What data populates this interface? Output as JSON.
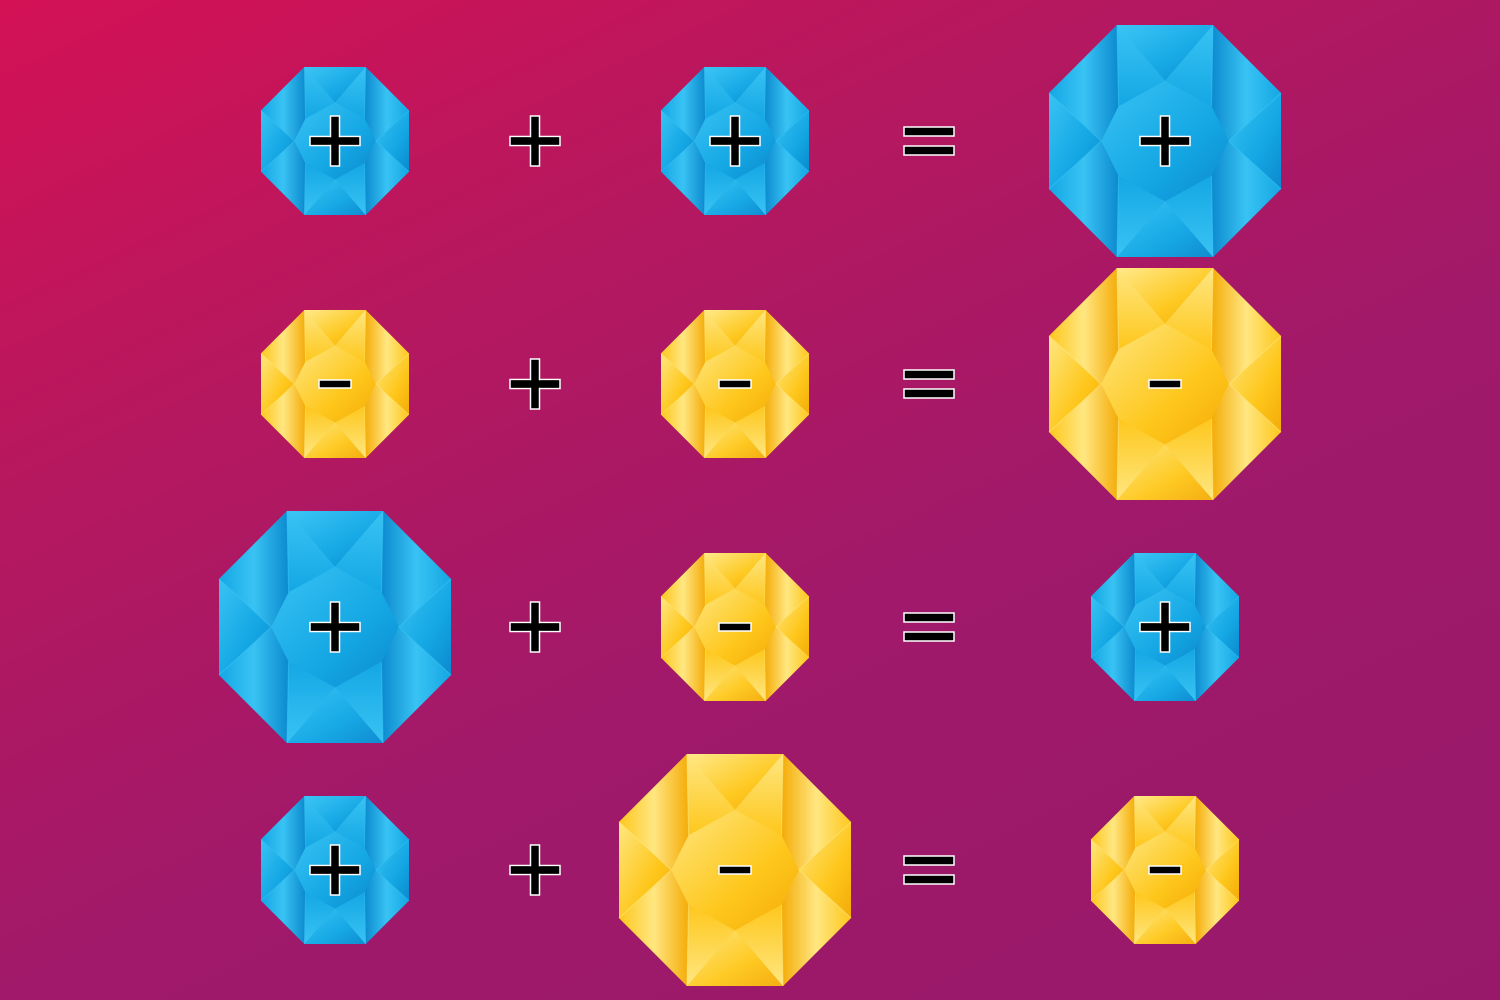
{
  "colors": {
    "blue_light": "#3dc6f5",
    "blue_mid": "#14a7e4",
    "blue_dark": "#0b86cc",
    "yellow_light": "#ffea8c",
    "yellow_mid": "#fec71c",
    "yellow_dark": "#f3a805",
    "symbol": "#000000",
    "symbol_outline": "#ffffff"
  },
  "equations": [
    {
      "terms": [
        {
          "charge": "+",
          "color": "blue",
          "size": "small"
        },
        {
          "charge": "+",
          "color": "blue",
          "size": "small"
        },
        {
          "charge": "+",
          "color": "blue",
          "size": "large"
        }
      ],
      "plus_operator": "+",
      "equals_operator": "="
    },
    {
      "terms": [
        {
          "charge": "-",
          "color": "yellow",
          "size": "small"
        },
        {
          "charge": "-",
          "color": "yellow",
          "size": "small"
        },
        {
          "charge": "-",
          "color": "yellow",
          "size": "large"
        }
      ],
      "plus_operator": "+",
      "equals_operator": "="
    },
    {
      "terms": [
        {
          "charge": "+",
          "color": "blue",
          "size": "large"
        },
        {
          "charge": "-",
          "color": "yellow",
          "size": "small"
        },
        {
          "charge": "+",
          "color": "blue",
          "size": "small"
        }
      ],
      "plus_operator": "+",
      "equals_operator": "="
    },
    {
      "terms": [
        {
          "charge": "+",
          "color": "blue",
          "size": "small"
        },
        {
          "charge": "-",
          "color": "yellow",
          "size": "large"
        },
        {
          "charge": "-",
          "color": "yellow",
          "size": "small"
        }
      ],
      "plus_operator": "+",
      "equals_operator": "="
    }
  ]
}
